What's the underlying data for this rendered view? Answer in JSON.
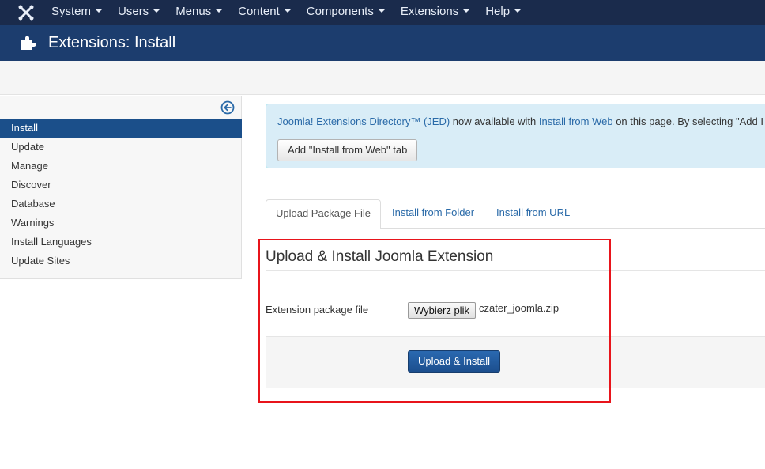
{
  "nav": {
    "items": [
      {
        "label": "System"
      },
      {
        "label": "Users"
      },
      {
        "label": "Menus"
      },
      {
        "label": "Content"
      },
      {
        "label": "Components"
      },
      {
        "label": "Extensions"
      },
      {
        "label": "Help"
      }
    ]
  },
  "header": {
    "title": "Extensions: Install"
  },
  "sidebar": {
    "items": [
      {
        "label": "Install",
        "active": true
      },
      {
        "label": "Update"
      },
      {
        "label": "Manage"
      },
      {
        "label": "Discover"
      },
      {
        "label": "Database"
      },
      {
        "label": "Warnings"
      },
      {
        "label": "Install Languages"
      },
      {
        "label": "Update Sites"
      }
    ]
  },
  "alert": {
    "link1": "Joomla! Extensions Directory™ (JED)",
    "text1": " now available with ",
    "link2": "Install from Web",
    "text2": " on this page.  By selecting \"Add I",
    "button": "Add \"Install from Web\" tab"
  },
  "tabs": [
    {
      "label": "Upload Package File",
      "active": true
    },
    {
      "label": "Install from Folder"
    },
    {
      "label": "Install from URL"
    }
  ],
  "panel": {
    "title": "Upload & Install Joomla Extension",
    "field_label": "Extension package file",
    "file_button": "Wybierz plik",
    "file_name": "czater_joomla.zip",
    "submit": "Upload & Install"
  },
  "colors": {
    "nav_bg": "#1a2b4c",
    "header_bg": "#1c3d6e",
    "active_item": "#1b4f8a",
    "highlight": "#e8141b"
  },
  "icons": {
    "logo": "joomla-logo-icon",
    "header": "puzzle-icon",
    "collapse": "arrow-left-circle-icon"
  }
}
